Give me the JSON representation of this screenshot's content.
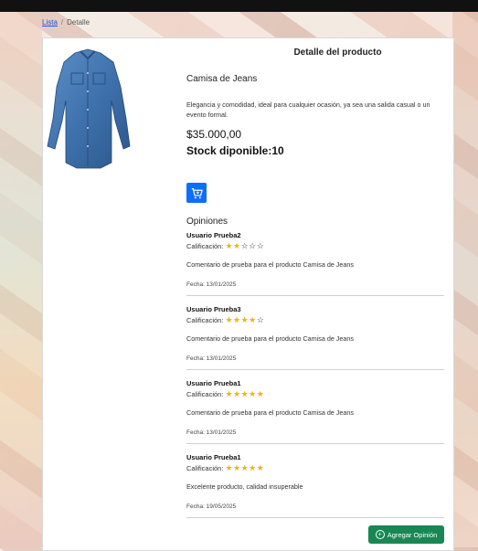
{
  "breadcrumb": {
    "link": "Lista",
    "separator": "/",
    "current": "Detalle"
  },
  "card": {
    "title": "Detalle del producto",
    "product": {
      "name": "Camisa de Jeans",
      "description": "Elegancia y comodidad, ideal para cualquier ocasión, ya sea una salida casual o un evento formal.",
      "price": "$35.000,00",
      "stock": "Stock diponible:10",
      "image_icon": "denim-shirt-image"
    },
    "cart_icon": "cart-plus-icon",
    "reviews_title": "Opiniones",
    "rating_label": "Calificación:",
    "reviews": [
      {
        "user": "Usuario Prueba2",
        "rating": 2,
        "comment": "Comentario de prueba para el producto Camisa de Jeans",
        "date": "Fecha: 13/01/2025"
      },
      {
        "user": "Usuario Prueba3",
        "rating": 4,
        "comment": "Comentario de prueba para el producto Camisa de Jeans",
        "date": "Fecha: 13/01/2025"
      },
      {
        "user": "Usuario Prueba1",
        "rating": 5,
        "comment": "Comentario de prueba para el producto Camisa de Jeans",
        "date": "Fecha: 13/01/2025"
      },
      {
        "user": "Usuario Prueba1",
        "rating": 5,
        "comment": "Excelente producto, calidad insuperable",
        "date": "Fecha: 19/05/2025"
      }
    ],
    "add_review_label": "Agregar Opinión",
    "colors": {
      "primary": "#0d6efd",
      "success": "#198754",
      "star": "#f5b301"
    }
  }
}
